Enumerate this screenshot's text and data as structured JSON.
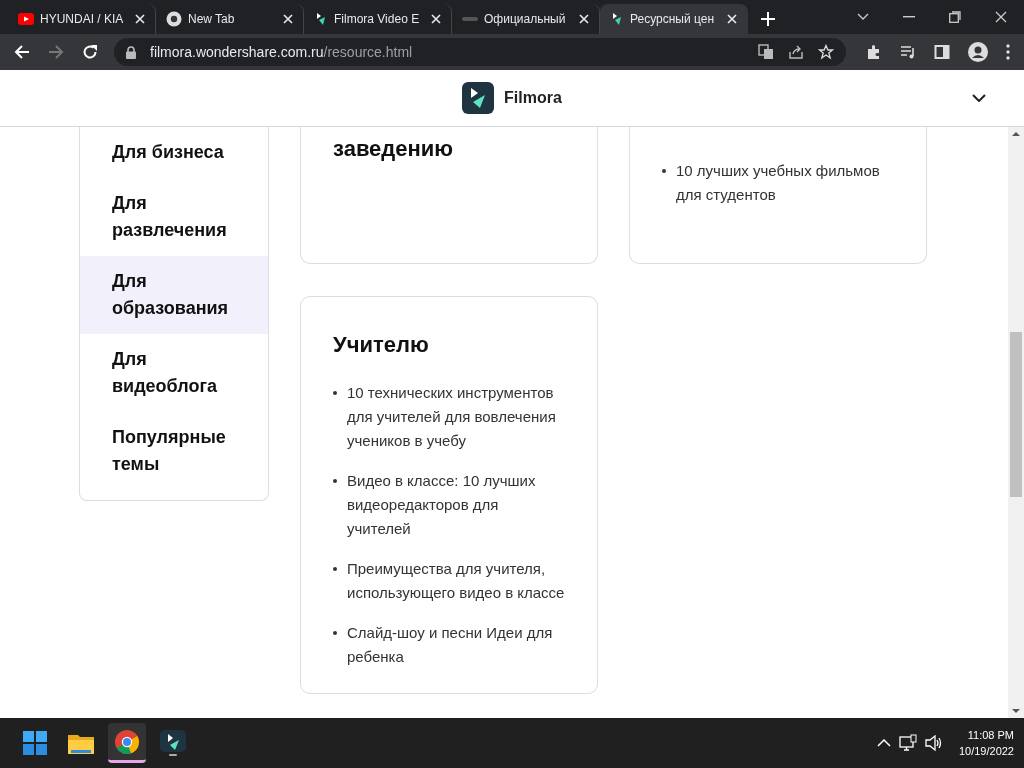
{
  "browser": {
    "tabs": [
      {
        "title": "HYUNDAI / KIA",
        "selected": false
      },
      {
        "title": "New Tab",
        "selected": false
      },
      {
        "title": "Filmora Video E",
        "selected": false
      },
      {
        "title": "Официальный",
        "selected": false
      },
      {
        "title": "Ресурсный цен",
        "selected": true
      }
    ],
    "url_host": "filmora.wondershare.com.ru",
    "url_path": "/resource.html"
  },
  "header": {
    "brand": "Filmora"
  },
  "sidebar": {
    "items": [
      {
        "label": "Для бизнеса",
        "selected": false
      },
      {
        "label": "Для развлечения",
        "selected": false
      },
      {
        "label": "Для образования",
        "selected": true
      },
      {
        "label": "Для видеоблога",
        "selected": false
      },
      {
        "label": "Популярные темы",
        "selected": false
      }
    ]
  },
  "cards": [
    {
      "title": "заведению"
    },
    {
      "links": [
        "10 лучших учебных фильмов для студентов"
      ]
    },
    {
      "title": "Учителю",
      "links": [
        "10 технических инструментов для учителей для вовлечения учеников в учебу",
        "Видео в классе: 10 лучших видеоредакторов для учителей",
        "Преимущества для учителя, использующего видео в классе",
        "Слайд-шоу и песни Идеи для ребенка"
      ]
    }
  ],
  "taskbar": {
    "apps": [
      {
        "active": false
      },
      {
        "active": true
      },
      {
        "active": false
      }
    ],
    "time": "11:08 PM",
    "date": "10/19/2022"
  }
}
